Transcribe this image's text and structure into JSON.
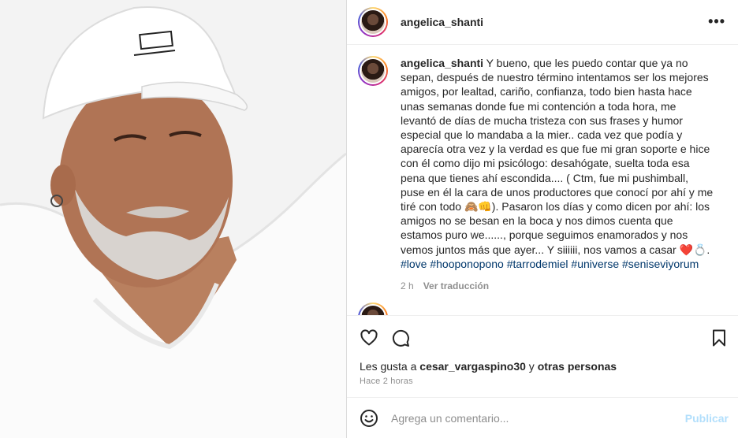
{
  "post": {
    "username": "angelica_shanti",
    "photo_alt": "photo-of-man-with-white-cap"
  },
  "caption": {
    "username": "angelica_shanti",
    "text_before_tags": " Y bueno, que les puedo contar que ya no sepan, después de nuestro término intentamos ser los mejores amigos, por lealtad, cariño, confianza, todo bien hasta hace unas semanas donde fue mi contención a toda hora, me levantó de días de mucha tristeza con sus frases y humor especial que lo mandaba a la mier.. cada vez que podía y aparecía otra vez y la verdad es que fue mi gran soporte e hice con él como dijo mi psicólogo: desahógate, suelta toda esa pena que tienes ahí escondida.... ( Ctm, fue mi pushimball, puse en él la cara de unos productores que conocí por ahí y me tiré con todo 🙈👊). Pasaron los días y como dicen por ahí: los amigos no se besan en la boca y nos dimos cuenta que estamos puro we......, porque seguimos enamorados y nos vemos juntos más que ayer... Y siiiiii, nos vamos a casar ❤️💍. ",
    "tags": [
      "#love",
      "#hooponopono",
      "#tarrodemiel",
      "#universe",
      "#seniseviyorum"
    ],
    "age": "2 h",
    "translate_label": "Ver traducción"
  },
  "likes": {
    "prefix": "Les gusta a ",
    "user": "cesar_vargaspino30",
    "middle": " y ",
    "others": "otras personas"
  },
  "timestamp": "Hace 2 horas",
  "comment_box": {
    "placeholder": "Agrega un comentario...",
    "publish_label": "Publicar"
  },
  "icons": {
    "like": "heart-icon",
    "comment": "comment-icon",
    "save": "bookmark-icon",
    "emoji": "smiley-icon",
    "more": "more-icon"
  },
  "colors": {
    "link": "#00376b",
    "muted": "#8e8e8e",
    "publish_disabled": "#b2dffc"
  }
}
